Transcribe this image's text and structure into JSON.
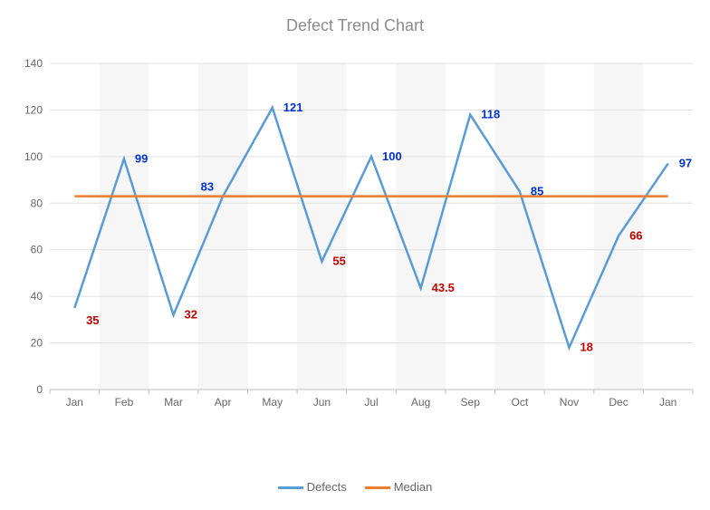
{
  "chart_data": {
    "type": "line",
    "title": "Defect Trend Chart",
    "ylim": [
      0,
      140
    ],
    "yticks": [
      0,
      20,
      40,
      60,
      80,
      100,
      120,
      140
    ],
    "categories": [
      "Jan",
      "Feb",
      "Mar",
      "Apr",
      "May",
      "Jun",
      "Jul",
      "Aug",
      "Sep",
      "Oct",
      "Nov",
      "Dec",
      "Jan"
    ],
    "series": [
      {
        "name": "Defects",
        "color": "#5b9bd5",
        "values": [
          35,
          99,
          32,
          83,
          121,
          55,
          100,
          43.5,
          118,
          85,
          18,
          66,
          97
        ]
      },
      {
        "name": "Median",
        "color": "#ed7d31",
        "values": [
          83,
          83,
          83,
          83,
          83,
          83,
          83,
          83,
          83,
          83,
          83,
          83,
          83
        ]
      }
    ],
    "data_labels": [
      {
        "x": 0,
        "value": 35,
        "color": "#c00000",
        "pos": "below"
      },
      {
        "x": 1,
        "value": 99,
        "color": "#0033cc",
        "pos": "right"
      },
      {
        "x": 2,
        "value": 32,
        "color": "#c00000",
        "pos": "right"
      },
      {
        "x": 3,
        "value": 83,
        "color": "#0033cc",
        "pos": "left"
      },
      {
        "x": 4,
        "value": 121,
        "color": "#0033cc",
        "pos": "right"
      },
      {
        "x": 5,
        "value": 55,
        "color": "#c00000",
        "pos": "right"
      },
      {
        "x": 6,
        "value": 100,
        "color": "#0033cc",
        "pos": "right"
      },
      {
        "x": 7,
        "value": 43.5,
        "color": "#c00000",
        "pos": "right"
      },
      {
        "x": 8,
        "value": 118,
        "color": "#0033cc",
        "pos": "right"
      },
      {
        "x": 9,
        "value": 85,
        "color": "#0033cc",
        "pos": "right"
      },
      {
        "x": 10,
        "value": 18,
        "color": "#c00000",
        "pos": "right"
      },
      {
        "x": 11,
        "value": 66,
        "color": "#c00000",
        "pos": "right"
      },
      {
        "x": 12,
        "value": 97,
        "color": "#0033cc",
        "pos": "right"
      }
    ],
    "legend_position": "bottom"
  }
}
